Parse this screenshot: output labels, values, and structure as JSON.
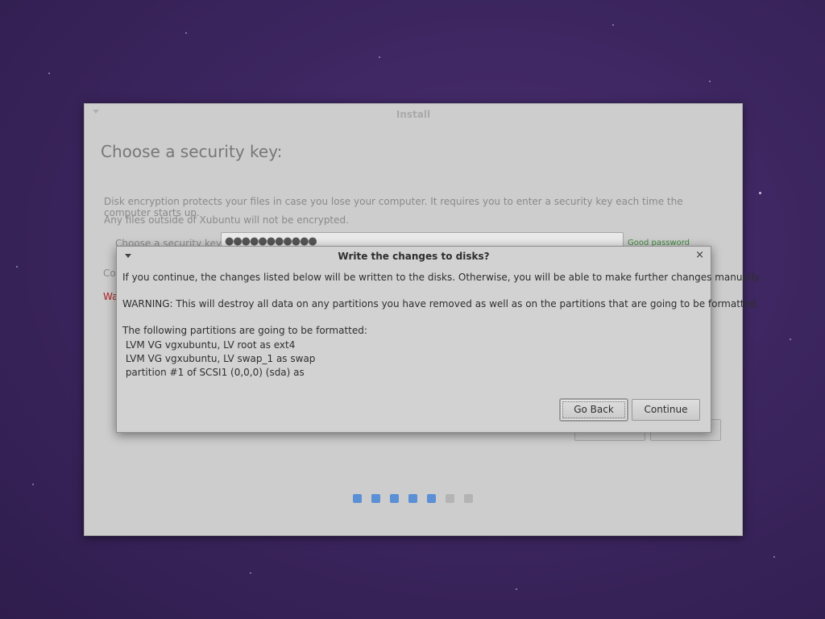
{
  "install_window": {
    "title": "Install",
    "page_title": "Choose a security key:",
    "description_line1": "Disk encryption protects your files in case you lose your computer. It requires you to enter a security key each time the computer starts up.",
    "description_line2": "Any files outside of Xubuntu will not be encrypted.",
    "security_key_label": "Choose a security key:",
    "security_key_value": "●●●●●●●●●●●",
    "password_strength": "Good password",
    "confirm_fragment": "Co",
    "warning_fragment": "Wa",
    "progress_steps": {
      "total": 7,
      "completed": 5
    },
    "colors": {
      "step_active": "#5b8fd6",
      "step_inactive": "#b4b4b4"
    }
  },
  "dialog": {
    "title": "Write the changes to disks?",
    "line1": "If you continue, the changes listed below will be written to the disks. Otherwise, you will be able to make further changes manually.",
    "line2": "WARNING: This will destroy all data on any partitions you have removed as well as on the partitions that are going to be formatted.",
    "line3": "The following partitions are going to be formatted:",
    "partitions": [
      " LVM VG vgxubuntu, LV root as ext4",
      " LVM VG vgxubuntu, LV swap_1 as swap",
      " partition #1 of SCSI1 (0,0,0) (sda) as"
    ],
    "go_back_label": "Go Back",
    "continue_label": "Continue",
    "close_icon": "×"
  }
}
